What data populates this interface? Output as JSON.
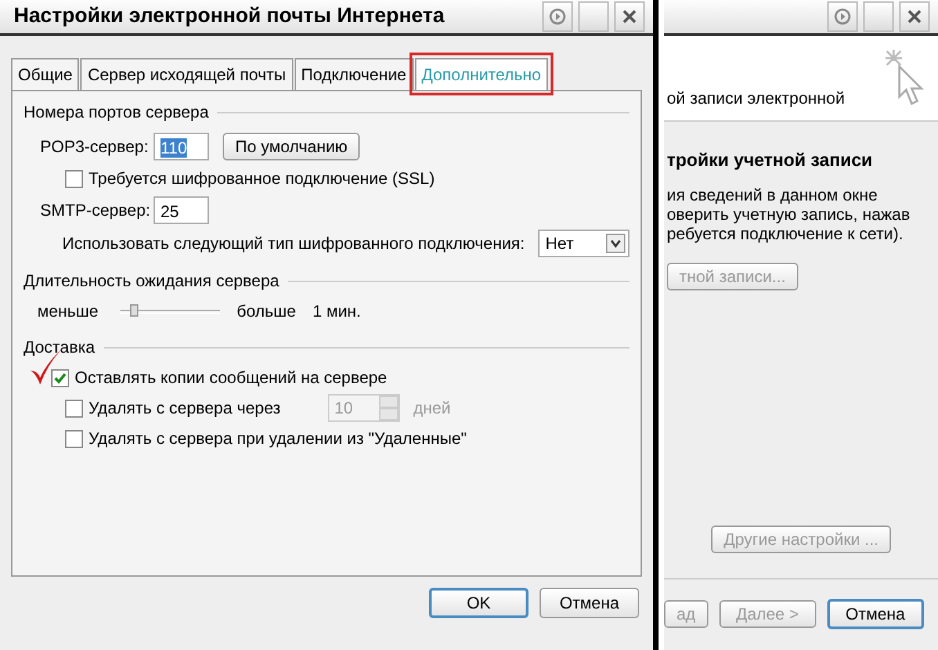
{
  "dialog": {
    "title": "Настройки электронной почты Интернета",
    "tabs": [
      {
        "label": "Общие",
        "selected": false,
        "highlighted": false
      },
      {
        "label": "Сервер исходящей почты",
        "selected": false,
        "highlighted": false
      },
      {
        "label": "Подключение",
        "selected": false,
        "highlighted": false
      },
      {
        "label": "Дополнительно",
        "selected": true,
        "highlighted": true
      }
    ],
    "server_ports": {
      "heading": "Номера портов сервера",
      "pop3": {
        "label": "POP3-сервер:",
        "value": "110",
        "selected": true
      },
      "default_button": "По умолчанию",
      "ssl": {
        "label": "Требуется шифрованное подключение (SSL)",
        "checked": false
      },
      "smtp": {
        "label": "SMTP-сервер:",
        "value": "25",
        "selected": false
      },
      "encryption": {
        "label": "Использовать следующий тип шифрованного подключения:",
        "value": "Нет"
      }
    },
    "timeout": {
      "heading": "Длительность ожидания сервера",
      "min_label": "меньше",
      "max_label": "больше",
      "level": 0.1,
      "reading": "1 мин."
    },
    "delivery": {
      "heading": "Доставка",
      "options": [
        {
          "kind": "checkbox",
          "label": "Оставлять копии сообщений на сервере",
          "checked": true,
          "annotated": true
        },
        {
          "kind": "days",
          "label": "Удалять с сервера через",
          "checked": false,
          "annotated": false,
          "value": "10",
          "unit": "дней",
          "disabled": true
        },
        {
          "kind": "checkbox",
          "label": "Удалять с сервера при удалении из \"Удаленные\"",
          "checked": false,
          "annotated": false
        }
      ]
    },
    "buttons": [
      {
        "label": "OK",
        "default": true
      },
      {
        "label": "Отмена",
        "default": false
      }
    ]
  },
  "background_window": {
    "header_text": "ой записи электронной",
    "section_title": "тройки учетной записи",
    "description_lines": [
      "ия сведений в данном окне",
      "оверить учетную запись, нажав",
      "ребуется подключение к сети)."
    ],
    "test_button": {
      "label": "тной записи...",
      "disabled": true
    },
    "more_button": {
      "label": "Другие настройки ...",
      "disabled": true
    },
    "nav_buttons": [
      {
        "label": "ад",
        "disabled": true,
        "default": false
      },
      {
        "label": "Далее >",
        "disabled": true,
        "default": false
      },
      {
        "label": "Отмена",
        "disabled": false,
        "default": true
      }
    ]
  }
}
